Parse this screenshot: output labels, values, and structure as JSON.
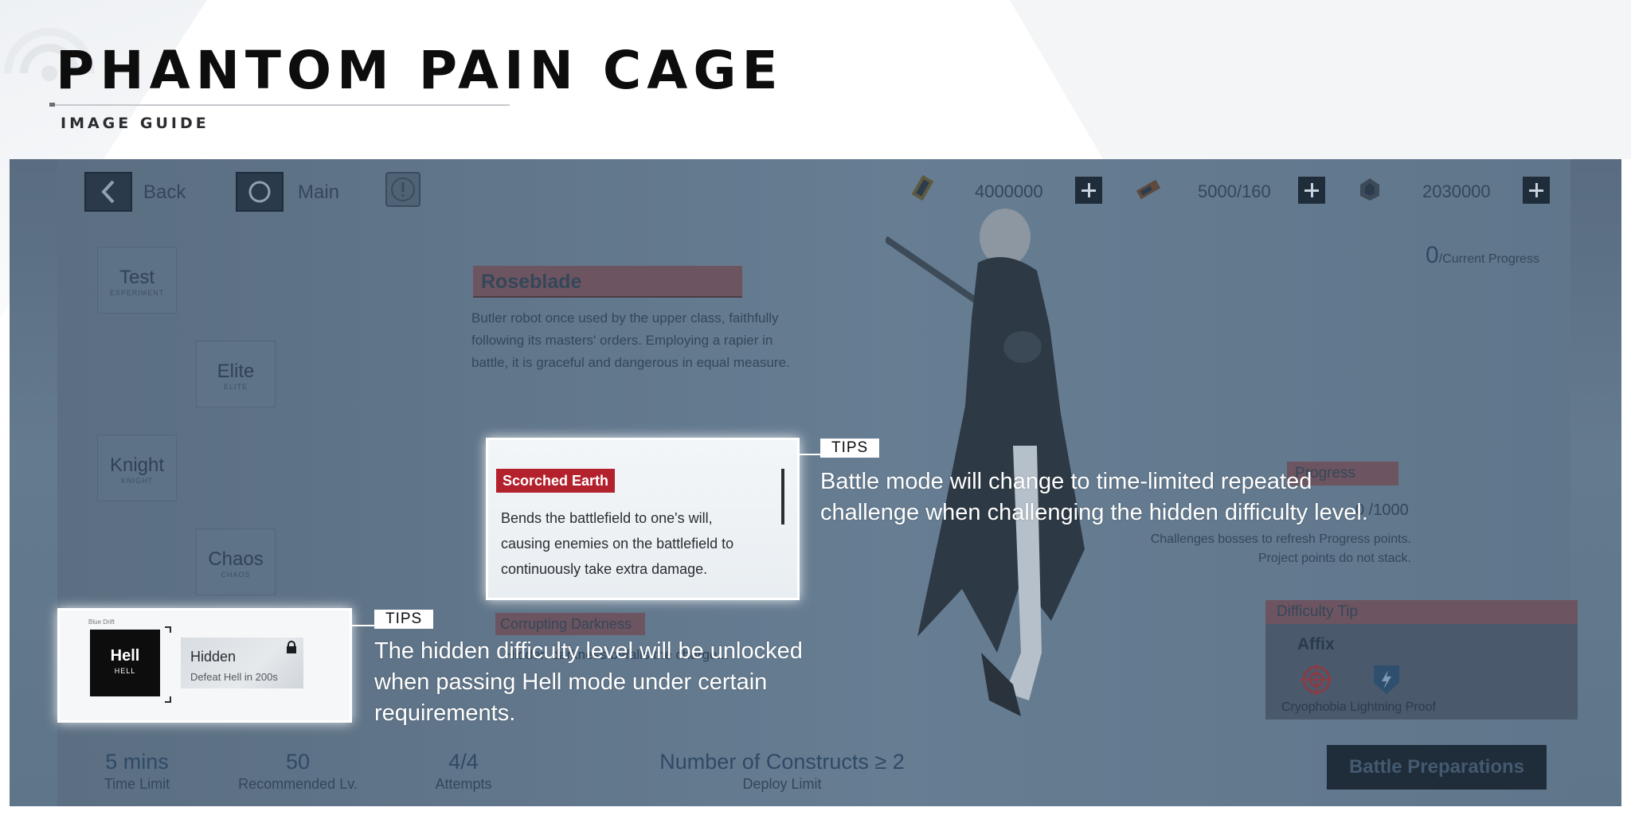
{
  "guide": {
    "title": "PHANTOM PAIN CAGE",
    "subtitle": "IMAGE GUIDE"
  },
  "topbar": {
    "back_label": "Back",
    "main_label": "Main",
    "resources": [
      {
        "icon": "gold-ticket-icon",
        "value": "4000000"
      },
      {
        "icon": "stamina-battery-icon",
        "value": "5000/160"
      },
      {
        "icon": "crystal-icon",
        "value": "2030000"
      }
    ]
  },
  "difficulties": [
    {
      "name": "Test",
      "sub": "EXPERIMENT"
    },
    {
      "name": "Elite",
      "sub": "ELITE"
    },
    {
      "name": "Knight",
      "sub": "KNIGHT"
    },
    {
      "name": "Chaos",
      "sub": "CHAOS"
    }
  ],
  "boss": {
    "name": "Roseblade",
    "description": "Butler robot once used by the upper class, faithfully following its masters' orders. Employing a rapier in battle, it is graceful and dangerous in equal measure."
  },
  "affixes": {
    "scorched": {
      "title": "Scorched Earth",
      "text": "Bends the battlefield to one's will, causing enemies on the battlefield to continuously take extra damage."
    },
    "corrupting": {
      "title": "Corrupting Darkness",
      "text": "Hidden darkness befalls the charge..."
    }
  },
  "progress": {
    "current_value": "0",
    "current_label": "/Current Progress",
    "header": "Progress",
    "value": "0 /1000",
    "note": "Challenges bosses to refresh Progress points. Project points do not stack."
  },
  "difficulty_tip": {
    "header": "Difficulty Tip",
    "affix_label": "Affix",
    "affix_names": "Cryophobia   Lightning Proof"
  },
  "hidden_mode": {
    "small_tag": "Blue Drift",
    "hell_title": "Hell",
    "hell_sub": "HELL",
    "hidden_name": "Hidden",
    "requirement": "Defeat Hell in 200s"
  },
  "bottom_stats": [
    {
      "value": "5 mins",
      "label": "Time Limit"
    },
    {
      "value": "50",
      "label": "Recommended Lv."
    },
    {
      "value": "4/4",
      "label": "Attempts"
    },
    {
      "value": "Number of Constructs ≥ 2",
      "label": "Deploy Limit"
    }
  ],
  "battle_button": "Battle Preparations",
  "tips": [
    {
      "tag": "TIPS",
      "text": "Battle mode will change to time-limited repeated challenge when challenging the hidden difficulty level."
    },
    {
      "tag": "TIPS",
      "text": "The hidden difficulty level will be unlocked when passing Hell mode under certain requirements."
    }
  ],
  "colors": {
    "accent_red": "#b3212c",
    "screen_overlay": "#5f7589",
    "dark_button": "#1f2c39"
  }
}
